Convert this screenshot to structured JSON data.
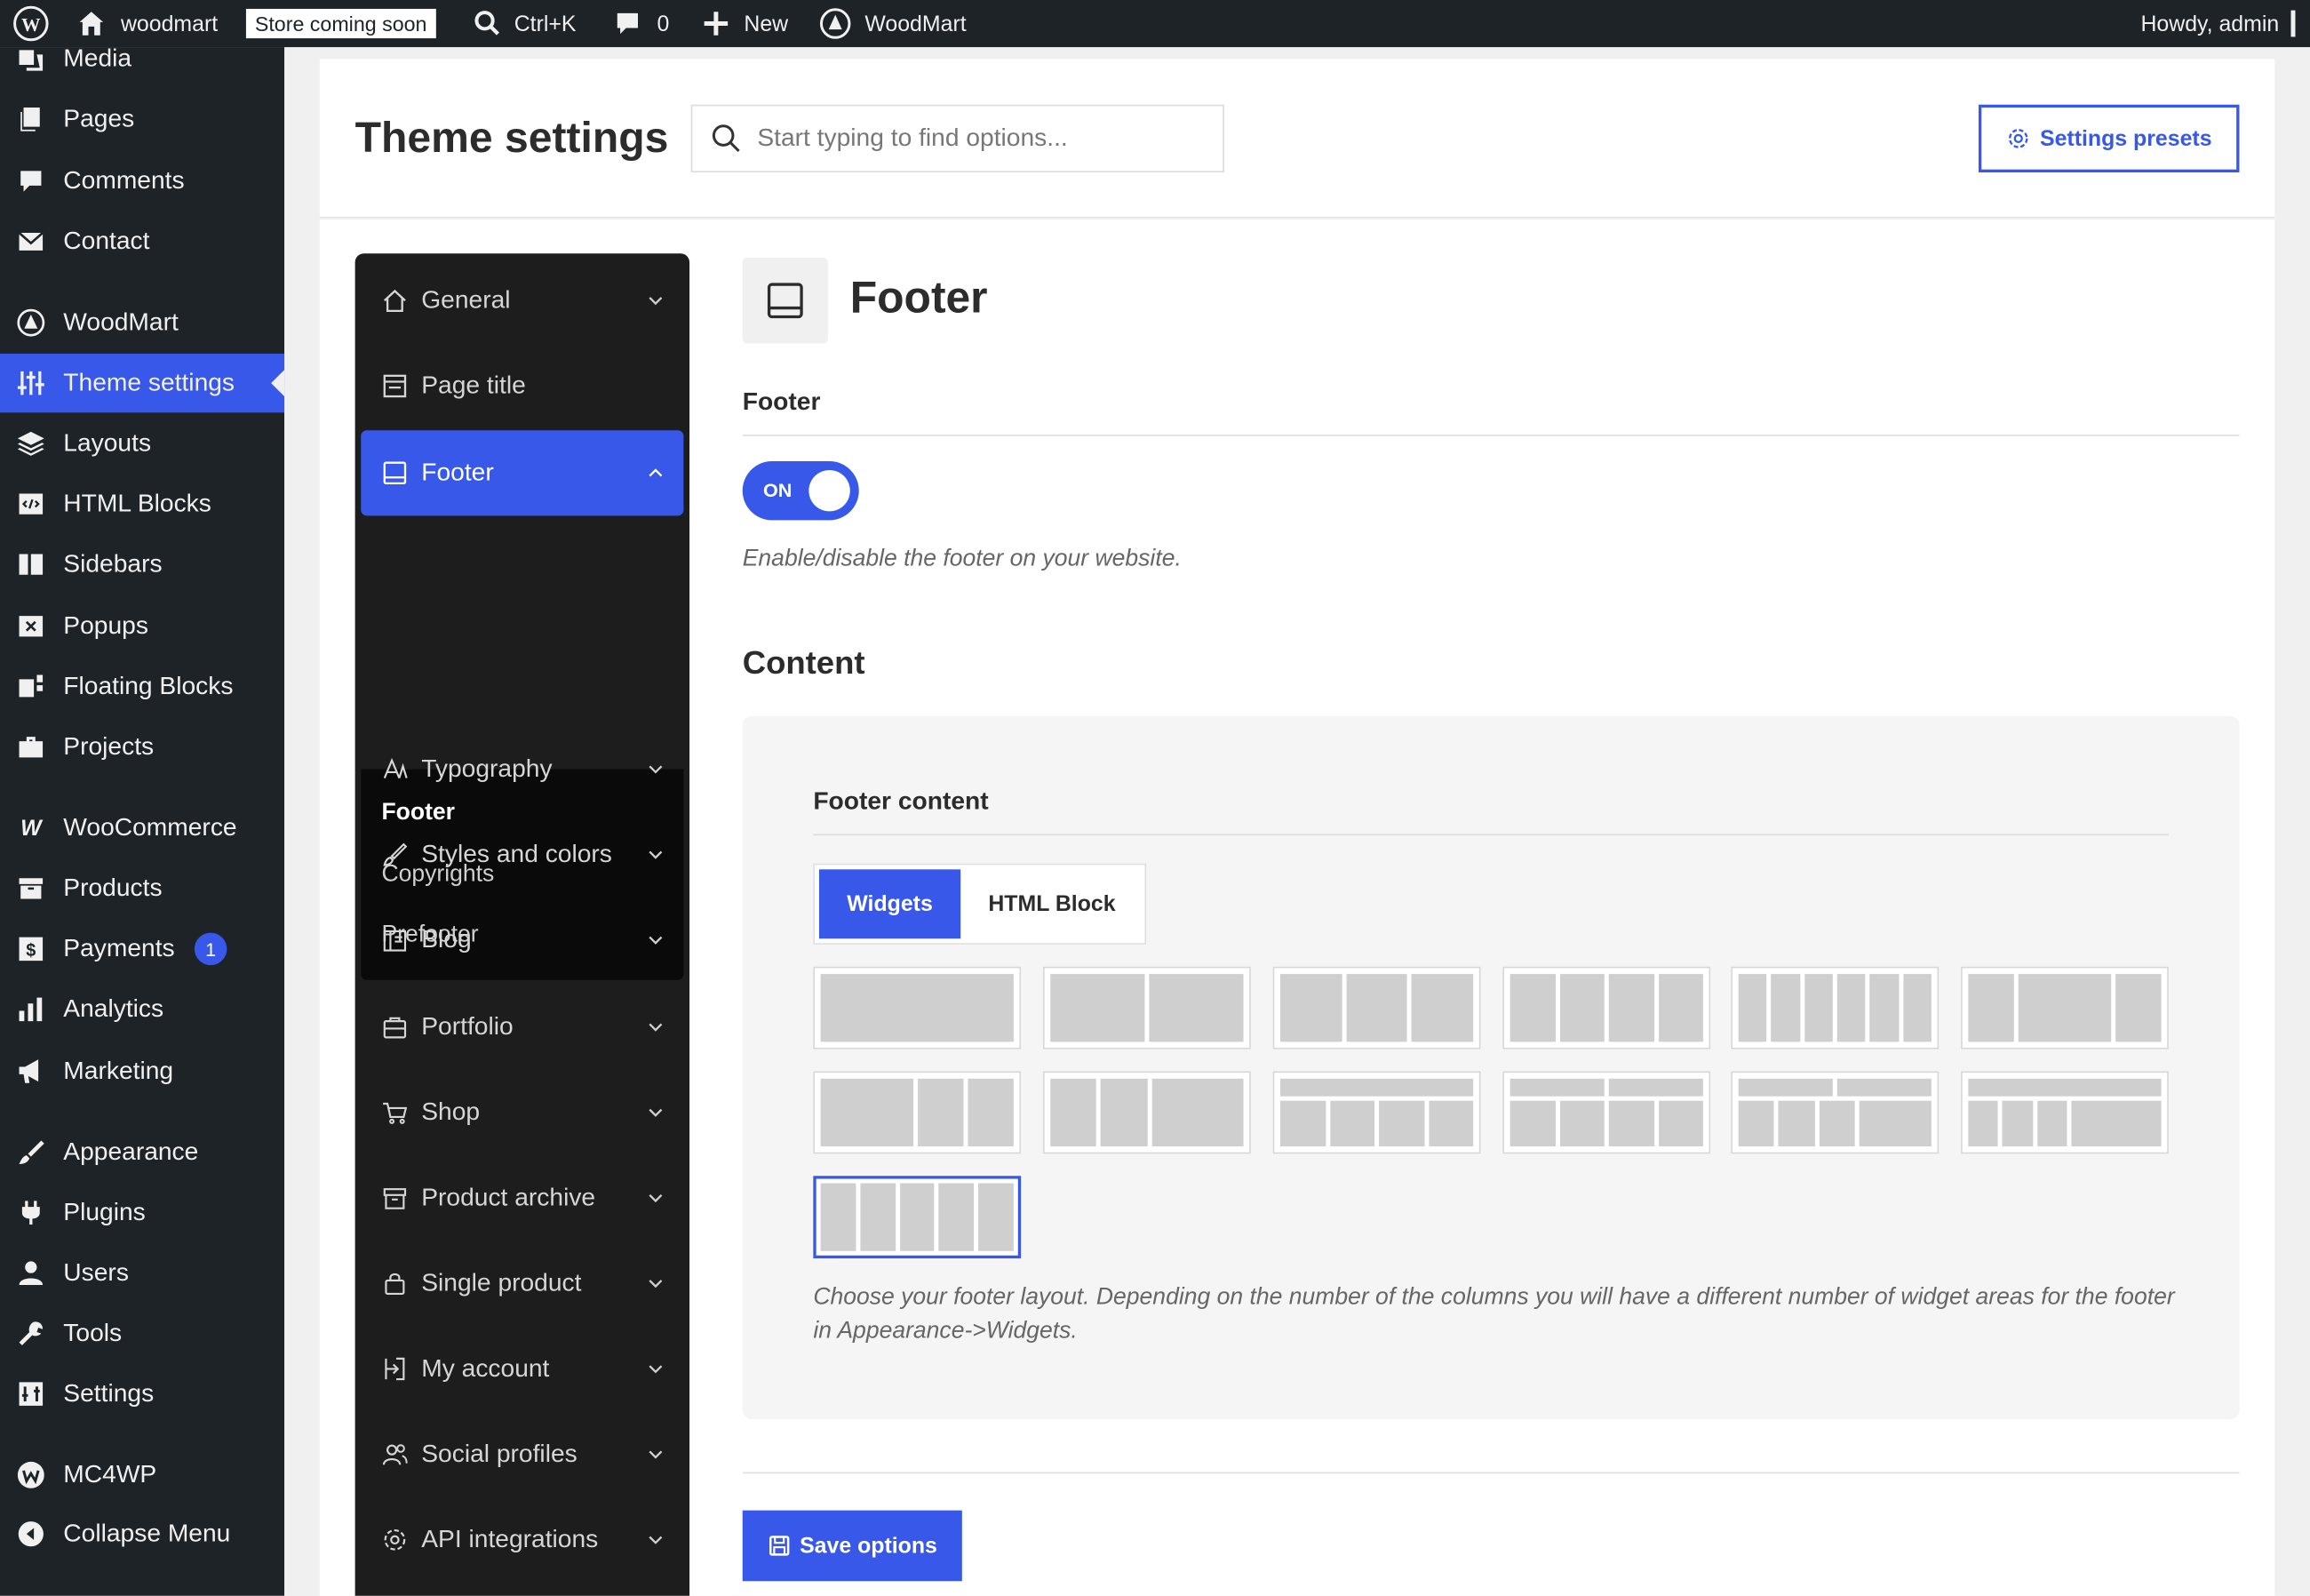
{
  "admin_bar": {
    "site_name": "woodmart",
    "store_badge": "Store coming soon",
    "search_shortcut": "Ctrl+K",
    "comments_count": "0",
    "new_label": "New",
    "plugin_label": "WoodMart",
    "greeting": "Howdy, admin"
  },
  "admin_menu": {
    "items": [
      {
        "label": "Media",
        "icon": "media-icon"
      },
      {
        "label": "Pages",
        "icon": "pages-icon"
      },
      {
        "label": "Comments",
        "icon": "comments-icon"
      },
      {
        "label": "Contact",
        "icon": "mail-icon"
      },
      {
        "label": "WoodMart",
        "icon": "woodmart-icon"
      },
      {
        "label": "Theme settings",
        "icon": "sliders-icon",
        "current": true
      },
      {
        "label": "Layouts",
        "icon": "layers-icon"
      },
      {
        "label": "HTML Blocks",
        "icon": "code-icon"
      },
      {
        "label": "Sidebars",
        "icon": "sidebar-icon"
      },
      {
        "label": "Popups",
        "icon": "popup-icon"
      },
      {
        "label": "Floating Blocks",
        "icon": "floating-icon"
      },
      {
        "label": "Projects",
        "icon": "briefcase-icon"
      },
      {
        "label": "WooCommerce",
        "icon": "woo-icon"
      },
      {
        "label": "Products",
        "icon": "archive-icon"
      },
      {
        "label": "Payments",
        "icon": "dollar-icon",
        "badge": "1"
      },
      {
        "label": "Analytics",
        "icon": "bar-chart-icon"
      },
      {
        "label": "Marketing",
        "icon": "megaphone-icon"
      },
      {
        "label": "Appearance",
        "icon": "brush-icon"
      },
      {
        "label": "Plugins",
        "icon": "plug-icon"
      },
      {
        "label": "Users",
        "icon": "user-icon"
      },
      {
        "label": "Tools",
        "icon": "wrench-icon"
      },
      {
        "label": "Settings",
        "icon": "settings-icon"
      },
      {
        "label": "MC4WP",
        "icon": "mc4wp-icon"
      },
      {
        "label": "Collapse Menu",
        "icon": "collapse-icon"
      }
    ]
  },
  "header": {
    "title": "Theme settings",
    "search_placeholder": "Start typing to find options...",
    "presets_label": "Settings presets"
  },
  "settings_nav": {
    "items": [
      {
        "label": "General",
        "icon": "home-icon"
      },
      {
        "label": "Page title",
        "icon": "page-title-icon"
      },
      {
        "label": "Footer",
        "icon": "footer-icon",
        "active": true
      },
      {
        "label": "Typography",
        "icon": "typography-icon"
      },
      {
        "label": "Styles and colors",
        "icon": "brush-icon"
      },
      {
        "label": "Blog",
        "icon": "blog-icon"
      },
      {
        "label": "Portfolio",
        "icon": "portfolio-icon"
      },
      {
        "label": "Shop",
        "icon": "cart-icon"
      },
      {
        "label": "Product archive",
        "icon": "archive-icon"
      },
      {
        "label": "Single product",
        "icon": "bag-icon"
      },
      {
        "label": "My account",
        "icon": "account-icon"
      },
      {
        "label": "Social profiles",
        "icon": "social-icon"
      },
      {
        "label": "API integrations",
        "icon": "gear-icon"
      }
    ],
    "sub_items": [
      {
        "label": "Footer",
        "current": true
      },
      {
        "label": "Copyrights"
      },
      {
        "label": "Prefooter"
      }
    ]
  },
  "section": {
    "title": "Footer",
    "footer_field_title": "Footer",
    "toggle_label": "ON",
    "toggle_state": "on",
    "toggle_description": "Enable/disable the footer on your website.",
    "content_heading": "Content",
    "footer_content_title": "Footer content",
    "tabs": [
      {
        "label": "Widgets",
        "active": true
      },
      {
        "label": "HTML Block"
      }
    ],
    "layout_options_count": 13,
    "selected_layout": 13,
    "layout_description": "Choose your footer layout. Depending on the number of the columns you will have a different number of widget areas for the footer in Appearance->Widgets.",
    "save_label": "Save options"
  },
  "colors": {
    "accent": "#3858e9",
    "admin_bar_bg": "#1d2327",
    "nav_bg": "#1d1d1d"
  }
}
